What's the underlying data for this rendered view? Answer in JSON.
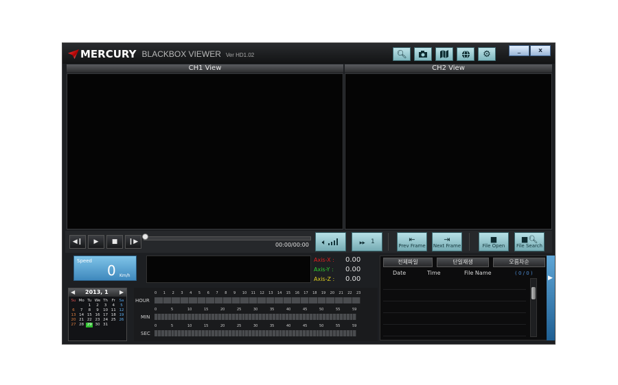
{
  "app": {
    "brand": "MERCURY",
    "subtitle": "BLACKBOX VIEWER",
    "version": "Ver HD1.02",
    "window_buttons": {
      "minimize": "_",
      "close": "x"
    },
    "toolbar_icons": [
      "zoom-in-icon",
      "camera-icon",
      "map-icon",
      "globe-icon",
      "gear-icon"
    ]
  },
  "views": {
    "ch1": "CH1 View",
    "ch2": "CH2 View"
  },
  "player": {
    "time": "00:00/00:00",
    "frame_step": "1",
    "prev_frame": "Prev Frame",
    "next_frame": "Next Frame",
    "file_open": "File Open",
    "file_search": "File Search",
    "progress": 0
  },
  "speed": {
    "label": "Speed",
    "value": "0",
    "unit": "Km/h"
  },
  "axes": [
    {
      "label": "Axis-X :",
      "value": "0.00",
      "color": "#e02020"
    },
    {
      "label": "Axis-Y :",
      "value": "0.00",
      "color": "#30d030"
    },
    {
      "label": "Axis-Z :",
      "value": "0.00",
      "color": "#e0d020"
    }
  ],
  "list": {
    "tabs": [
      "전체파일",
      "단일재생",
      "오름차순"
    ],
    "columns": [
      "Date",
      "Time",
      "File Name"
    ],
    "count": "( 0 / 0 )"
  },
  "calendar": {
    "title": "2013, 1",
    "weekdays": [
      "Su",
      "Mo",
      "Tu",
      "We",
      "Th",
      "Fr",
      "Sa"
    ],
    "rows": [
      [
        "",
        "",
        "1",
        "2",
        "3",
        "4",
        "5"
      ],
      [
        "6",
        "7",
        "8",
        "9",
        "10",
        "11",
        "12"
      ],
      [
        "13",
        "14",
        "15",
        "16",
        "17",
        "18",
        "19"
      ],
      [
        "20",
        "21",
        "22",
        "23",
        "24",
        "25",
        "26"
      ],
      [
        "27",
        "28",
        "29",
        "30",
        "31",
        "",
        ""
      ]
    ],
    "selected": "29"
  },
  "timeline": {
    "hour_label": "HOUR",
    "min_label": "MIN",
    "sec_label": "SEC",
    "hours": [
      "0",
      "1",
      "2",
      "3",
      "4",
      "5",
      "6",
      "7",
      "8",
      "9",
      "10",
      "11",
      "12",
      "13",
      "14",
      "15",
      "16",
      "17",
      "18",
      "19",
      "20",
      "21",
      "22",
      "23"
    ],
    "minutes": [
      "0",
      "5",
      "10",
      "15",
      "20",
      "25",
      "30",
      "35",
      "40",
      "45",
      "50",
      "55",
      "59"
    ],
    "seconds": [
      "0",
      "5",
      "10",
      "15",
      "20",
      "25",
      "30",
      "35",
      "40",
      "45",
      "50",
      "55",
      "59"
    ]
  }
}
